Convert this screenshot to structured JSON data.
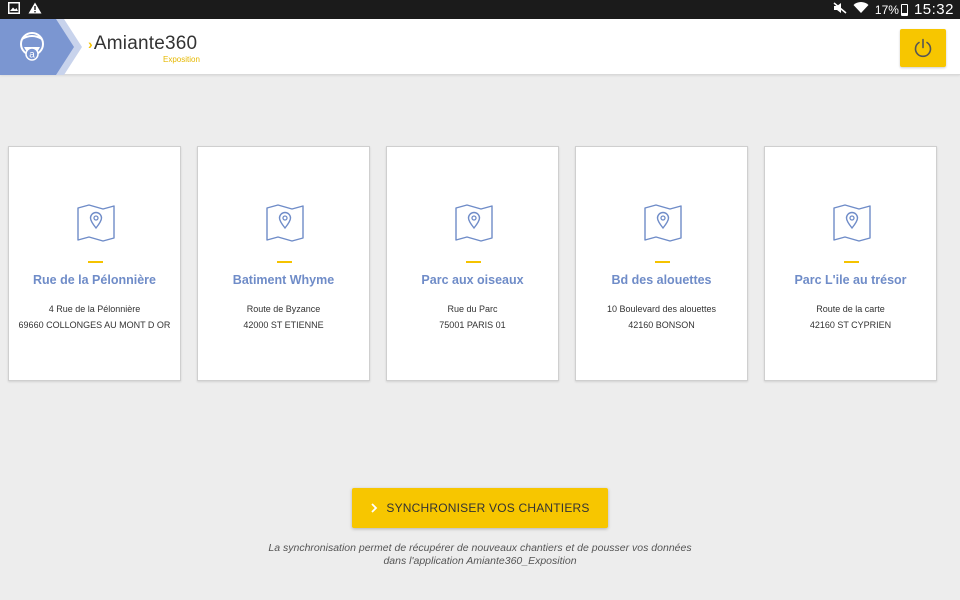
{
  "status_bar": {
    "battery": "17%",
    "time": "15:32",
    "icons": [
      "gallery-icon",
      "warning-icon",
      "mute-icon",
      "wifi-icon",
      "battery-icon"
    ]
  },
  "header": {
    "brand_name": "Amiante360",
    "brand_sub": "Exposition",
    "logo_letter": "a",
    "colors": {
      "accent": "#f7c600",
      "logo_blue": "#7b96d1",
      "title_blue": "#6f8cc8"
    }
  },
  "chantiers": [
    {
      "title": "Rue de la Pélonnière",
      "address1": "4 Rue de la Pélonnière",
      "address2": "69660 COLLONGES AU MONT D OR"
    },
    {
      "title": "Batiment Whyme",
      "address1": "Route de Byzance",
      "address2": "42000 ST ETIENNE"
    },
    {
      "title": "Parc aux oiseaux",
      "address1": "Rue du Parc",
      "address2": "75001 PARIS 01"
    },
    {
      "title": "Bd des alouettes",
      "address1": "10 Boulevard des alouettes",
      "address2": "42160 BONSON"
    },
    {
      "title": "Parc L'ile au trésor",
      "address1": "Route de la carte",
      "address2": "42160 ST CYPRIEN"
    }
  ],
  "sync": {
    "button_label": "SYNCHRONISER VOS CHANTIERS",
    "note_line1": "La synchronisation permet de récupérer de nouveaux chantiers et de pousser vos données",
    "note_line2": "dans l'application Amiante360_Exposition"
  }
}
